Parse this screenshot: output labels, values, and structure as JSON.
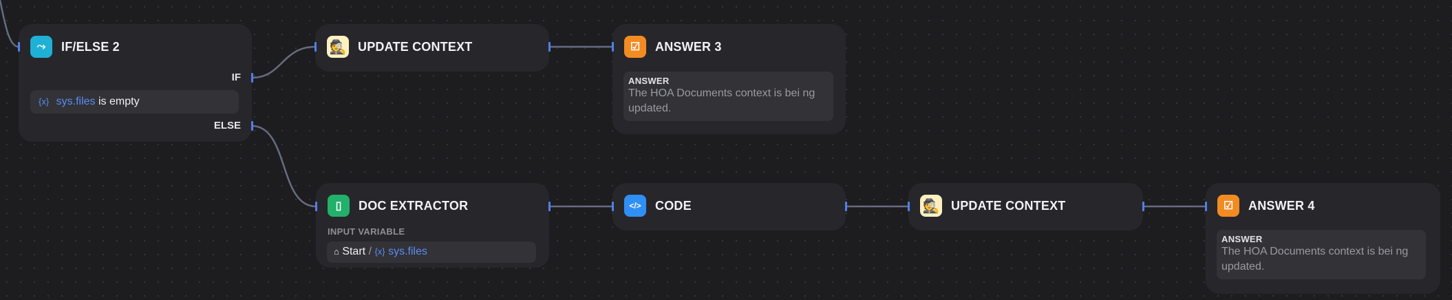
{
  "colors": {
    "canvas": "#1d1d20",
    "node": "#27272b",
    "edge": "#676c80",
    "handle": "#4f80ee",
    "variable": "#5b8ef5"
  },
  "ifelse": {
    "title": "IF/ELSE 2",
    "icon": "branch-icon",
    "if_label": "IF",
    "else_label": "ELSE",
    "condition": {
      "var_icon": "{x}",
      "variable": "sys.files",
      "operator": "is empty"
    }
  },
  "update_context_1": {
    "title": "UPDATE CONTEXT",
    "icon": "detective-emoji-icon"
  },
  "answer_3": {
    "title": "ANSWER 3",
    "icon": "answer-chat-icon",
    "field_label": "ANSWER",
    "text": "The HOA Documents context is bei ng updated."
  },
  "doc_extractor": {
    "title": "DOC EXTRACTOR",
    "icon": "doc-extractor-icon",
    "input_label": "INPUT VARIABLE",
    "source": "Start",
    "separator": "/",
    "var_icon": "{x}",
    "variable": "sys.files"
  },
  "code": {
    "title": "CODE",
    "icon": "code-icon",
    "glyph": "</>"
  },
  "update_context_2": {
    "title": "UPDATE CONTEXT",
    "icon": "detective-emoji-icon"
  },
  "answer_4": {
    "title": "ANSWER 4",
    "icon": "answer-chat-icon",
    "field_label": "ANSWER",
    "text": "The HOA Documents context is bei ng updated."
  }
}
